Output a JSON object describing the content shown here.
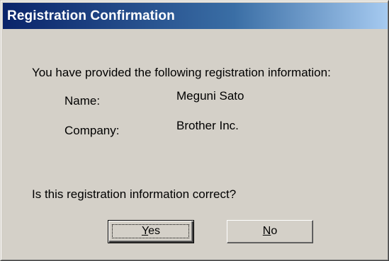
{
  "window": {
    "title": "Registration Confirmation"
  },
  "body": {
    "intro_text": "You have provided the following registration information:",
    "fields": [
      {
        "label": "Name:",
        "value": "Meguni Sato"
      },
      {
        "label": "Company:",
        "value": "Brother Inc."
      }
    ],
    "question": "Is this registration information correct?"
  },
  "buttons": {
    "yes": {
      "mnemonic": "Y",
      "rest": "es"
    },
    "no": {
      "mnemonic": "N",
      "rest": "o"
    }
  },
  "colors": {
    "titlebar_start": "#0a246a",
    "titlebar_end": "#a6caf0",
    "dialog_face": "#d4d0c8"
  }
}
